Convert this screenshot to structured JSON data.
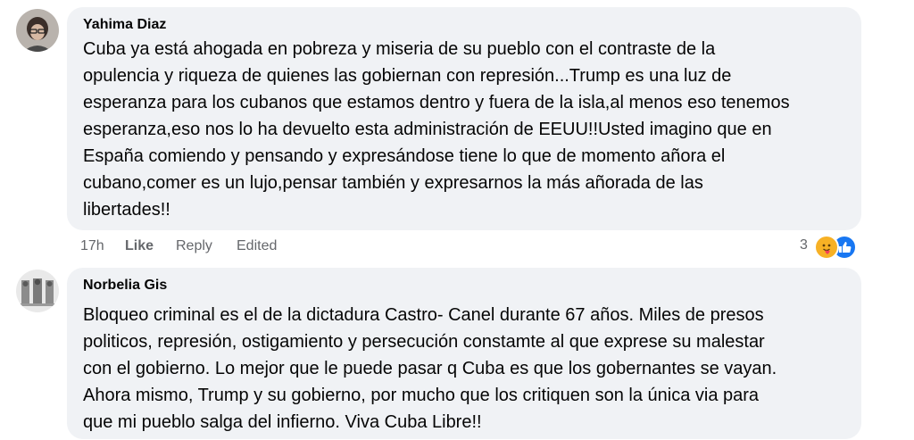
{
  "comments": [
    {
      "author": "Yahima Diaz",
      "text": "Cuba ya está ahogada en pobreza y miseria de su pueblo con el contraste de la\nopulencia y riqueza de quienes las gobiernan con represión...Trump es una luz de\nesperanza para los cubanos que estamos dentro y fuera de la isla,al menos eso tenemos\nesperanza,eso nos lo ha devuelto esta administración de EEUU!!Usted imagino que en\nEspaña comiendo y pensando y expresándose tiene lo que de momento añora el\ncubano,comer es un lujo,pensar también y expresarnos la más añorada de las\nlibertades!!",
      "time": "17h",
      "like_label": "Like",
      "reply_label": "Reply",
      "edited_label": "Edited",
      "reaction_count": "3",
      "reaction_icons": [
        "care-emoji-icon",
        "like-thumb-icon"
      ]
    },
    {
      "author": "Norbelia Gis",
      "text": "Bloqueo criminal es el de la dictadura Castro- Canel durante 67 años. Miles de presos\npoliticos, represión, ostigamiento y persecución constamte al que exprese su malestar\ncon el gobierno. Lo mejor que le puede pasar q Cuba es que los gobernantes se vayan.\nAhora mismo, Trump y su gobierno, por mucho que los critiquen son la única via para\nque mi pueblo salga del infierno. Viva Cuba Libre!!"
    }
  ],
  "colors": {
    "bubble": "#f0f2f5",
    "meta_text": "#65676b",
    "like_blue": "#1877f2",
    "care_yellow": "#f7b125"
  }
}
